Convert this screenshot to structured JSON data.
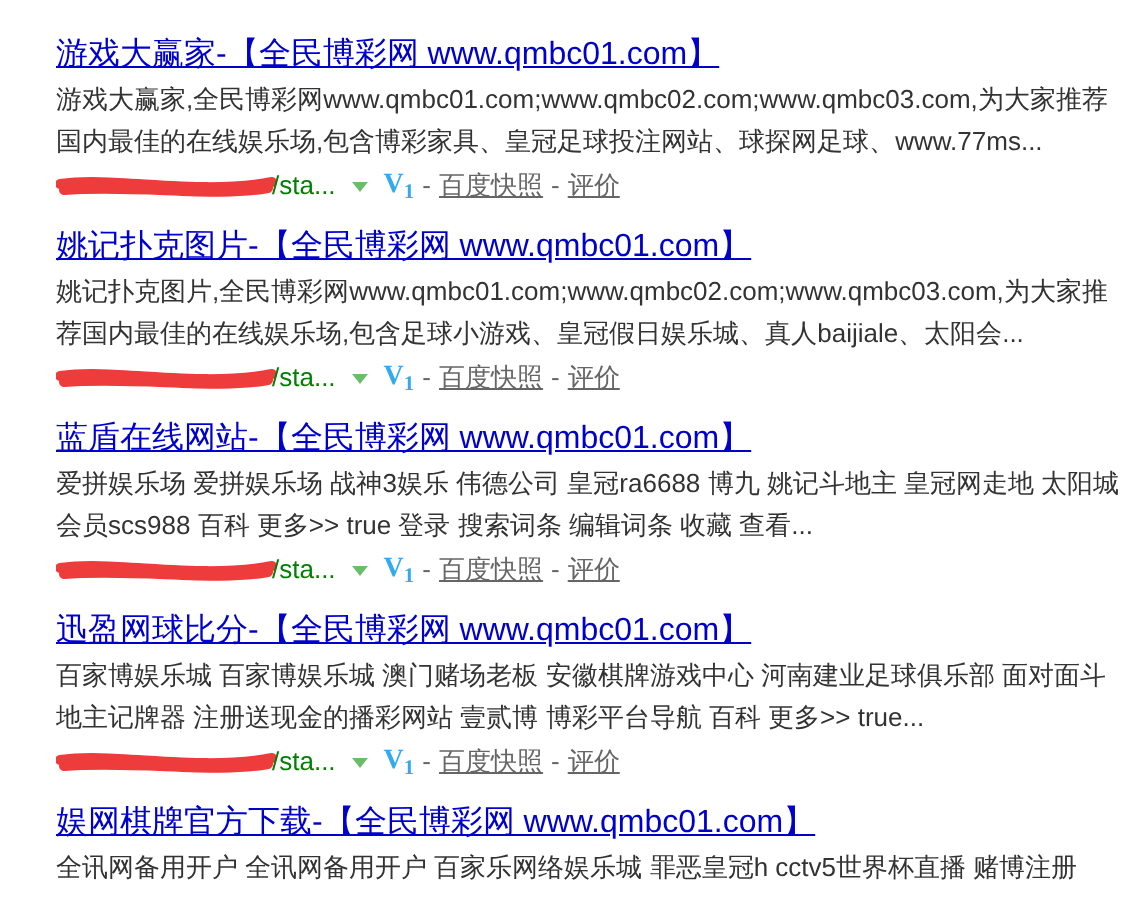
{
  "results": [
    {
      "title": "游戏大赢家-【全民博彩网 www.qmbc01.com】",
      "snippet": "游戏大赢家,全民博彩网www.qmbc01.com;www.qmbc02.com;www.qmbc03.com,为大家推荐国内最佳的在线娱乐场,包含博彩家具、皇冠足球投注网站、球探网足球、www.77ms...",
      "url": "/sta...",
      "badge": "V$_{1}$",
      "sep1": "-",
      "snapshot": "百度快照",
      "sep2": "-",
      "review": "评价"
    },
    {
      "title": "姚记扑克图片-【全民博彩网 www.qmbc01.com】",
      "snippet": "姚记扑克图片,全民博彩网www.qmbc01.com;www.qmbc02.com;www.qmbc03.com,为大家推荐国内最佳的在线娱乐场,包含足球小游戏、皇冠假日娱乐城、真人baijiale、太阳会...",
      "url": "/sta...",
      "badge": "V$_{1}$",
      "sep1": "-",
      "snapshot": "百度快照",
      "sep2": "-",
      "review": "评价"
    },
    {
      "title": "蓝盾在线网站-【全民博彩网 www.qmbc01.com】",
      "snippet": "爱拼娱乐场 爱拼娱乐场 战神3娱乐 伟德公司 皇冠ra6688 博九 姚记斗地主 皇冠网走地 太阳城会员scs988 百科 更多>> true 登录 搜索词条 编辑词条 收藏 查看...",
      "url": "/sta...",
      "badge": "V$_{1}$",
      "sep1": "-",
      "snapshot": "百度快照",
      "sep2": "-",
      "review": "评价"
    },
    {
      "title": "迅盈网球比分-【全民博彩网 www.qmbc01.com】",
      "snippet": "百家博娱乐城 百家博娱乐城 澳门赌场老板 安徽棋牌游戏中心 河南建业足球俱乐部 面对面斗地主记牌器 注册送现金的播彩网站 壹贰博 博彩平台导航 百科 更多>> true...",
      "url": "/sta...",
      "badge": "V$_{1}$",
      "sep1": "-",
      "snapshot": "百度快照",
      "sep2": "-",
      "review": "评价"
    },
    {
      "title": "娱网棋牌官方下载-【全民博彩网 www.qmbc01.com】",
      "snippet": "全讯网备用开户 全讯网备用开户 百家乐网络娱乐城 罪恶皇冠h cctv5世界杯直播 赌博注册"
    }
  ]
}
